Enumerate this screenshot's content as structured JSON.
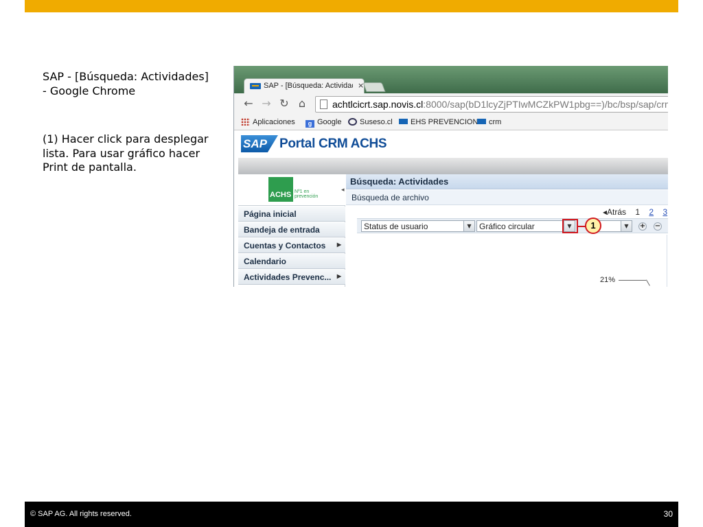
{
  "slide": {
    "title": "SAP - [Búsqueda: Actividades] - Google Chrome",
    "instruction": "(1) Hacer click para desplegar lista.  Para usar gráfico hacer Print de pantalla."
  },
  "browser": {
    "tab_title": "SAP - [Búsqueda: Actividade",
    "tab_close": "×",
    "url_host": "achtlcicrt.sap.novis.cl",
    "url_rest": ":8000/sap(bD1lcyZjPTIwMCZkPW1pbg==)/bc/bsp/sap/crm",
    "bookmarks": [
      "Aplicaciones",
      "Google",
      "Suseso.cl",
      "EHS PREVENCION",
      "crm"
    ]
  },
  "portal": {
    "logo_text": "SAP",
    "title": "Portal CRM ACHS",
    "achs_logo": "ACHS",
    "achs_tagline": "Nº1 en prevención",
    "nav_items": [
      {
        "label": "Página inicial",
        "has_submenu": false
      },
      {
        "label": "Bandeja de entrada",
        "has_submenu": false
      },
      {
        "label": "Cuentas y Contactos",
        "has_submenu": true
      },
      {
        "label": "Calendario",
        "has_submenu": false
      },
      {
        "label": "Actividades Prevenc...",
        "has_submenu": true
      }
    ],
    "content_title": "Búsqueda: Actividades",
    "sub_title": "Búsqueda de archivo",
    "pager": {
      "back": "◂Atrás",
      "pages": [
        "1",
        "2",
        "3"
      ]
    },
    "dropdown_status": "Status de usuario",
    "dropdown_chart": "Gráfico circular",
    "callout_number": "1",
    "percent_label": "21%"
  },
  "footer": {
    "copyright": "©  SAP AG. All rights reserved.",
    "page_number": "30"
  },
  "colors": {
    "accent_gold": "#f0ab00",
    "sap_blue": "#0f4c97",
    "achs_green": "#2e9d4e",
    "highlight_red": "#d0161d"
  }
}
